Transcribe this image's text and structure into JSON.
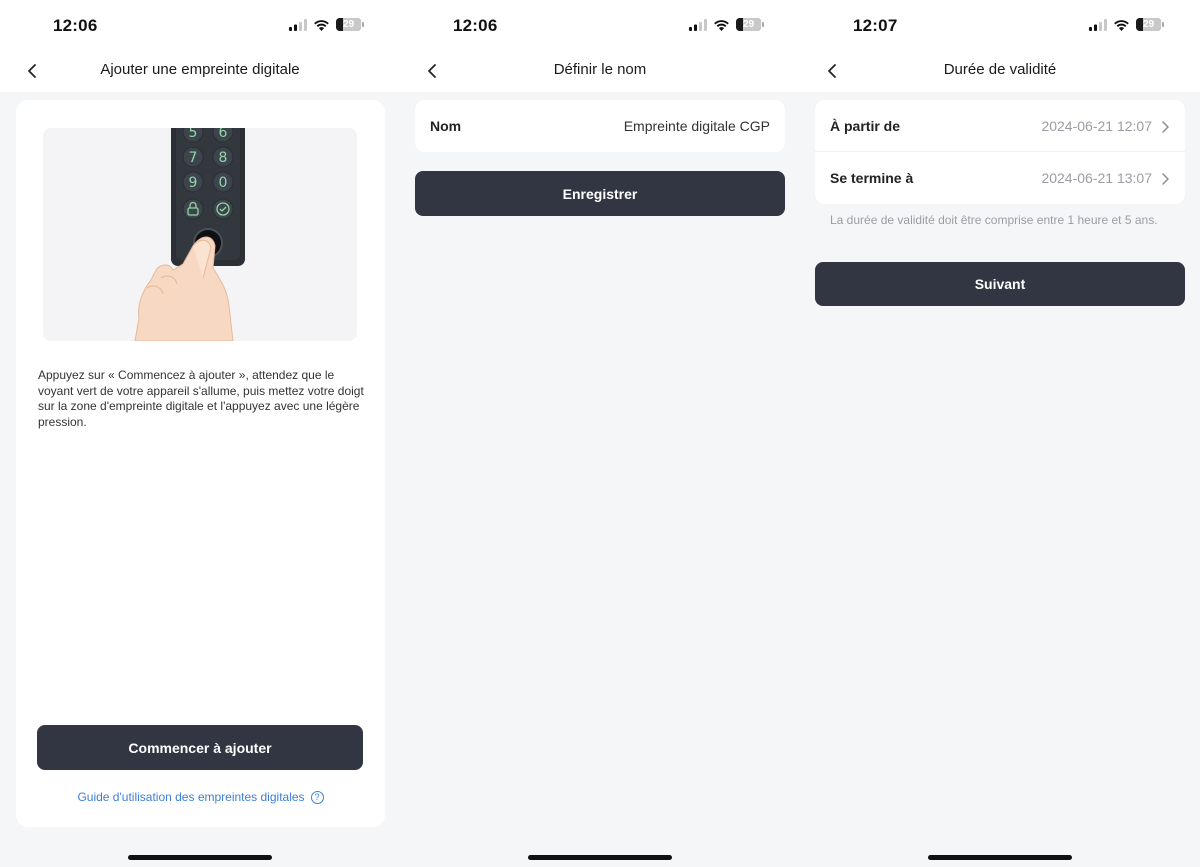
{
  "screens": [
    {
      "status": {
        "time": "12:06",
        "battery": "29",
        "battery_level": 0.29
      },
      "nav": {
        "title": "Ajouter une empreinte digitale"
      },
      "keypad_digits": [
        "5",
        "6",
        "7",
        "8",
        "9",
        "0"
      ],
      "instructions": "Appuyez sur « Commencez à ajouter », attendez que le voyant vert de votre appareil s'allume, puis mettez votre doigt sur la zone d'empreinte digitale et l'appuyez avec une légère pression.",
      "start_button": "Commencer à ajouter",
      "guide_link": "Guide d'utilisation des empreintes digitales",
      "help_glyph": "?"
    },
    {
      "status": {
        "time": "12:06",
        "battery": "29",
        "battery_level": 0.29
      },
      "nav": {
        "title": "Définir le nom"
      },
      "name_label": "Nom",
      "name_value": "Empreinte digitale CGP",
      "save_button": "Enregistrer"
    },
    {
      "status": {
        "time": "12:07",
        "battery": "29",
        "battery_level": 0.29
      },
      "nav": {
        "title": "Durée de validité"
      },
      "rows": [
        {
          "label": "À partir de",
          "value": "2024-06-21 12:07"
        },
        {
          "label": "Se termine à",
          "value": "2024-06-21 13:07"
        }
      ],
      "hint": "La durée de validité doit être comprise entre 1 heure et 5 ans.",
      "next_button": "Suivant"
    }
  ],
  "colors": {
    "primary_button": "#323643",
    "link": "#3d7fd6",
    "background": "#f5f6f8",
    "secondary_text": "#9a9da3",
    "keypad_glow": "#8fd6a8"
  },
  "icons": [
    "chevron-left-icon",
    "signal-icon",
    "wifi-icon",
    "battery-icon",
    "chevron-right-icon",
    "help-circle-icon"
  ]
}
